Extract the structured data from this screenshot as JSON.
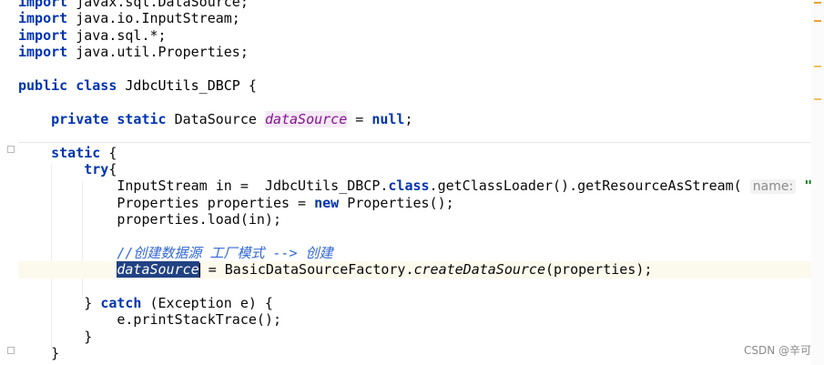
{
  "code": {
    "imports": [
      "javax.sql.DataSource;",
      "java.io.InputStream;",
      "java.sql.*;",
      "java.util.Properties;"
    ],
    "kw_import": "import",
    "kw_public": "public",
    "kw_class": "class",
    "class_name": "JdbcUtils_DBCP",
    "open_brace": " {",
    "kw_private": "private",
    "kw_static": "static",
    "field_type": "DataSource",
    "field_name": "dataSource",
    "assign": " = ",
    "kw_null": "null",
    "semicolon": ";",
    "static_brace": " {",
    "kw_try": "try",
    "try_brace": "{",
    "line_instream_prefix": "InputStream in =  JdbcUtils_DBCP.",
    "kw_class_lit": "class",
    "line_instream_mid": ".getClassLoader().getResourceAsStream(",
    "param_hint": "name:",
    "string_arg": "\"dbcpconfi",
    "line_props_prefix": "Properties properties = ",
    "kw_new": "new",
    "line_props_suffix": " Properties();",
    "line_load": "properties.load(in);",
    "comment": "//创建数据源 工厂模式 --> 创建",
    "line_create_mid": " = BasicDataSourceFactory.",
    "method_create": "createDataSource",
    "line_create_suffix": "(properties);",
    "catch_prefix": "} ",
    "kw_catch": "catch",
    "catch_suffix": " (Exception e) {",
    "line_print": "e.printStackTrace();",
    "close_brace": "}"
  },
  "watermark": "CSDN @辛可",
  "colors": {
    "keyword": "#0033b3",
    "field": "#871094",
    "string": "#067d17",
    "comment": "#3367d6",
    "selection": "#214283"
  }
}
